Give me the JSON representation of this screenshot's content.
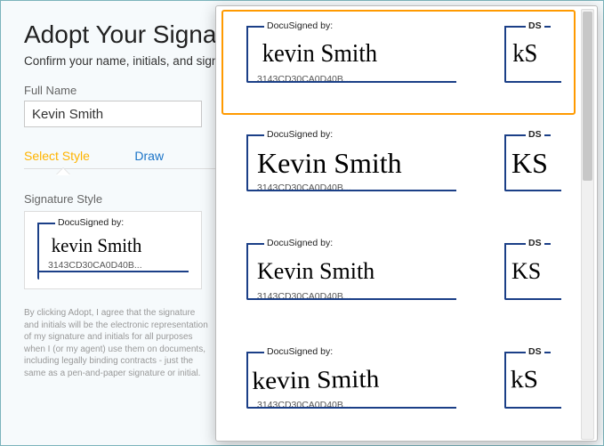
{
  "header": {
    "title": "Adopt Your Signature",
    "subtitle": "Confirm your name, initials, and signature."
  },
  "fields": {
    "full_name_label": "Full Name",
    "full_name_value": "Kevin Smith"
  },
  "tabs": {
    "select_style": "Select Style",
    "draw": "Draw"
  },
  "preview": {
    "section_label": "Signature Style",
    "docusigned_by": "DocuSigned by:",
    "ds_label": "DS",
    "signature_text": "kevin Smith",
    "initials_text": "kS",
    "hash": "3143CD30CA0D40B..."
  },
  "disclaimer": "By clicking Adopt, I agree that the signature and initials will be the electronic representation of my signature and initials for all purposes when I (or my agent) use them on documents, including legally binding contracts - just the same as a pen-and-paper signature or initial.",
  "styles": [
    {
      "signature": "kevin Smith",
      "initials": "kS",
      "hash": "3143CD30CA0D40B...",
      "selected": true
    },
    {
      "signature": "Kevin Smith",
      "initials": "KS",
      "hash": "3143CD30CA0D40B...",
      "selected": false
    },
    {
      "signature": "Kevin Smith",
      "initials": "KS",
      "hash": "3143CD30CA0D40B...",
      "selected": false
    },
    {
      "signature": "kevin Smith",
      "initials": "kS",
      "hash": "3143CD30CA0D40B...",
      "selected": false
    }
  ]
}
